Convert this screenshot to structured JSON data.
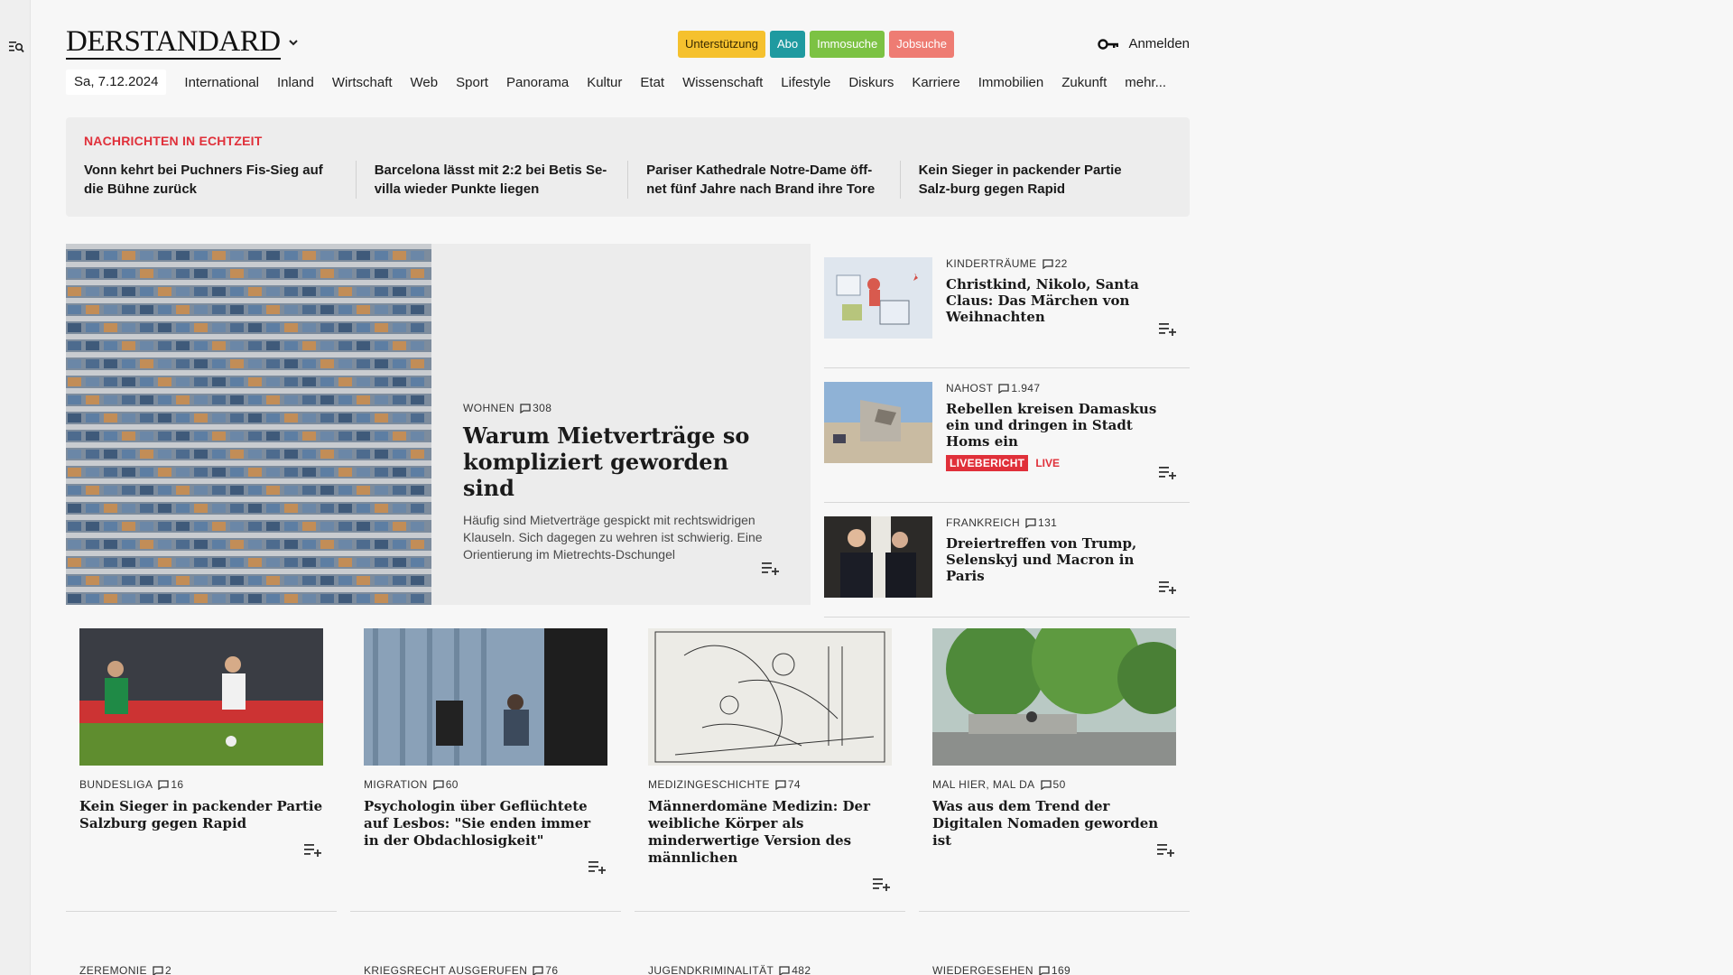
{
  "header": {
    "logo": "DERSTANDARD",
    "pills": [
      {
        "label": "Unterstützung",
        "bg": "#f5c12e",
        "fg": "#3a2a00"
      },
      {
        "label": "Abo",
        "bg": "#1f9aa0",
        "fg": "#ffffff"
      },
      {
        "label": "Immosuche",
        "bg": "#7cc243",
        "fg": "#ffffff"
      },
      {
        "label": "Jobsuche",
        "bg": "#ee7c73",
        "fg": "#ffffff"
      }
    ],
    "login": "Anmelden"
  },
  "nav": {
    "date": "Sa, 7.12.2024",
    "items": [
      "International",
      "Inland",
      "Wirtschaft",
      "Web",
      "Sport",
      "Panorama",
      "Kultur",
      "Etat",
      "Wissenschaft",
      "Lifestyle",
      "Diskurs",
      "Karriere",
      "Immobilien",
      "Zukunft",
      "mehr..."
    ]
  },
  "ticker": {
    "heading": "NACHRICHTEN IN ECHTZEIT",
    "items": [
      "Vonn kehrt bei Puchners Fis-Sieg auf die Bühne zurück",
      "Barcelona lässt mit 2:2 bei Betis Se-villa wieder Punkte liegen",
      "Pariser Kathedrale Notre-Dame öff-net fünf Jahre nach Brand ihre Tore",
      "Kein Sieger in packender Partie Salz-burg gegen Rapid"
    ]
  },
  "hero": {
    "kicker": "WOHNEN",
    "comments": "308",
    "title": "Warum Mietverträge so kompliziert geworden sind",
    "teaser": "Häufig sind Mietverträge gespickt mit rechtswidrigen Klauseln. Sich dagegen zu wehren ist schwierig. Eine Orientierung im Mietrechts-Dschungel"
  },
  "side": [
    {
      "kicker": "KINDERTRÄUME",
      "comments": "22",
      "title": "Christkind, Nikolo, Santa Claus: Das Märchen von Weihnachten"
    },
    {
      "kicker": "NAHOST",
      "comments": "1.947",
      "title": "Rebellen kreisen Damaskus ein und dringen in Stadt Homs ein",
      "badge": "LIVEBERICHT",
      "live": "LIVE"
    },
    {
      "kicker": "FRANKREICH",
      "comments": "131",
      "title": "Dreiertreffen von Trump, Selenskyj und Macron in Paris"
    }
  ],
  "cards": [
    {
      "kicker": "BUNDESLIGA",
      "comments": "16",
      "title": "Kein Sieger in packender Partie Salzburg gegen Rapid"
    },
    {
      "kicker": "MIGRATION",
      "comments": "60",
      "title": "Psychologin über Geflüchtete auf Lesbos: \"Sie enden immer in der Obdachlosigkeit\""
    },
    {
      "kicker": "MEDIZINGESCHICHTE",
      "comments": "74",
      "title": "Männerdomäne Medizin: Der weibliche Körper als minderwertige Version des männlichen"
    },
    {
      "kicker": "MAL HIER, MAL DA",
      "comments": "50",
      "title": "Was aus dem Trend der Digitalen Nomaden geworden ist"
    }
  ],
  "row2": [
    {
      "kicker": "ZEREMONIE",
      "comments": "2"
    },
    {
      "kicker": "KRIEGSRECHT AUSGERUFEN",
      "comments": "76"
    },
    {
      "kicker": "JUGENDKRIMINALITÄT",
      "comments": "482"
    },
    {
      "kicker": "WIEDERGESEHEN",
      "comments": "169"
    }
  ]
}
